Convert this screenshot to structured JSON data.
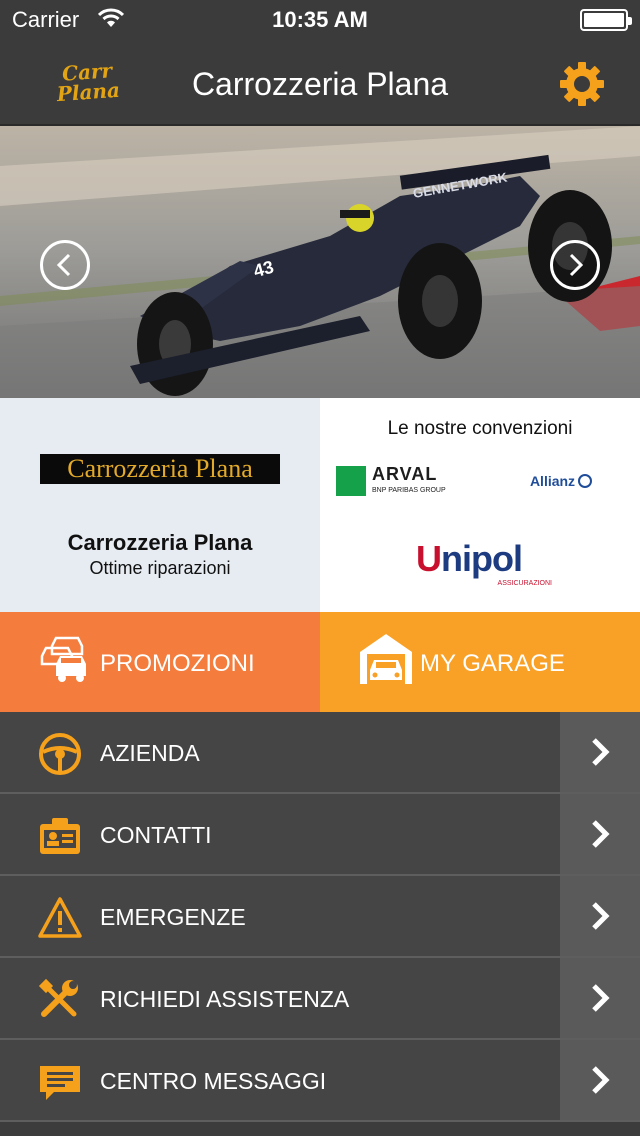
{
  "status_bar": {
    "carrier": "Carrier",
    "time": "10:35 AM",
    "battery_level": 1.0
  },
  "nav": {
    "logo_line1": "Carr",
    "logo_line2": "Plana",
    "title": "Carrozzeria Plana",
    "settings_icon": "gear-icon"
  },
  "hero": {
    "car_number": "43",
    "sponsor_text": "GENNETWORK",
    "prev_icon": "chevron-left-icon",
    "next_icon": "chevron-right-icon"
  },
  "company": {
    "logo_text": "Carrozzeria Plana",
    "name": "Carrozzeria Plana",
    "tagline": "Ottime riparazioni"
  },
  "partners": {
    "title": "Le nostre convenzioni",
    "arval_name": "ARVAL",
    "arval_sub": "BNP PARIBAS GROUP",
    "allianz_name": "Allianz",
    "unipol_name_first": "U",
    "unipol_name_rest": "nipol",
    "unipol_sub": "ASSICURAZIONI"
  },
  "tiles": [
    {
      "label": "PROMOZIONI",
      "icon": "cars-icon",
      "color": "#f47c3c"
    },
    {
      "label": "MY GARAGE",
      "icon": "garage-icon",
      "color": "#f9a026"
    }
  ],
  "menu": [
    {
      "label": "AZIENDA",
      "icon": "steering-wheel-icon"
    },
    {
      "label": "CONTATTI",
      "icon": "contact-card-icon"
    },
    {
      "label": "EMERGENZE",
      "icon": "warning-icon"
    },
    {
      "label": "RICHIEDI ASSISTENZA",
      "icon": "tools-icon"
    },
    {
      "label": "CENTRO MESSAGGI",
      "icon": "message-icon"
    }
  ],
  "colors": {
    "accent_orange": "#f9a026",
    "promo_orange": "#f47c3c",
    "menu_bg": "#454545",
    "topbar_bg": "#3b3b3b"
  }
}
